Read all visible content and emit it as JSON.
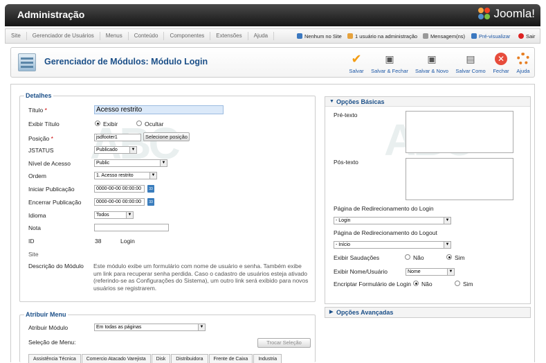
{
  "header": {
    "title": "Administração",
    "logo_text": "Joomla!"
  },
  "menu": {
    "items": [
      "Site",
      "Gerenciador de Usuários",
      "Menus",
      "Conteúdo",
      "Componentes",
      "Extensões",
      "Ajuda"
    ],
    "status": {
      "no_site": "Nenhum no Site",
      "admins": "1 usuário na administração",
      "messages": "Mensagem(ns)",
      "preview": "Pré-visualizar",
      "logout": "Sair"
    }
  },
  "toolbar": {
    "title": "Gerenciador de Módulos: Módulo Login",
    "buttons": {
      "save": "Salvar",
      "save_close": "Salvar & Fechar",
      "save_new": "Salvar & Novo",
      "save_copy": "Salvar Como",
      "close": "Fechar",
      "help": "Ajuda"
    }
  },
  "details": {
    "legend": "Detalhes",
    "title_label": "Título",
    "title_value": "Acesso restrito",
    "show_title_label": "Exibir Título",
    "show_option": "Exibir",
    "hide_option": "Ocultar",
    "position_label": "Posição",
    "position_value": "jsdfooter1",
    "select_position": "Selecione posição",
    "status_label": "JSTATUS",
    "status_value": "Publicado",
    "access_label": "Nível de Acesso",
    "access_value": "Public",
    "order_label": "Ordem",
    "order_value": "1. Acesso restrito",
    "start_label": "Iniciar Publicação",
    "start_value": "0000-00-00 00:00:00",
    "end_label": "Encerrar Publicação",
    "end_value": "0000-00-00 00:00:00",
    "lang_label": "Idioma",
    "lang_value": "Todos",
    "note_label": "Nota",
    "note_value": "",
    "id_label": "ID",
    "id_value": "38",
    "module_type": "Login",
    "site_label": "Site",
    "desc_label": "Descrição do Módulo",
    "desc_text": "Este módulo exibe um formulário com nome de usuário e senha. Também exibe um link para recuperar senha perdida. Caso o cadastro de usuários esteja ativado (referindo-se as Configurações do Sistema), um outro link será exibido para novos usuários se registrarem."
  },
  "assign": {
    "legend": "Atribuir Menu",
    "module_label": "Atribuir Módulo",
    "module_value": "Em todas as páginas",
    "selection_label": "Seleção de Menu:",
    "toggle_button": "Trocar Seleção",
    "tabs": [
      "Assistência Técnica",
      "Comercio Atacado Varejista",
      "Disk",
      "Distribuidora",
      "Frente de Caixa",
      "Industria"
    ]
  },
  "basic": {
    "heading": "Opções Básicas",
    "pretext_label": "Pré-texto",
    "posttext_label": "Pós-texto",
    "login_redirect_label": "Página de Redirecionamento do Login",
    "login_redirect_value": "- Login",
    "logout_redirect_label": "Página de Redirecionamento do Logout",
    "logout_redirect_value": "- Início",
    "greeting_label": "Exibir Saudações",
    "no": "Não",
    "yes": "Sim",
    "name_label": "Exibir Nome/Usuário",
    "name_value": "Nome",
    "encrypt_label": "Encriptar Formulário de Login"
  },
  "advanced": {
    "heading": "Opções Avançadas"
  }
}
